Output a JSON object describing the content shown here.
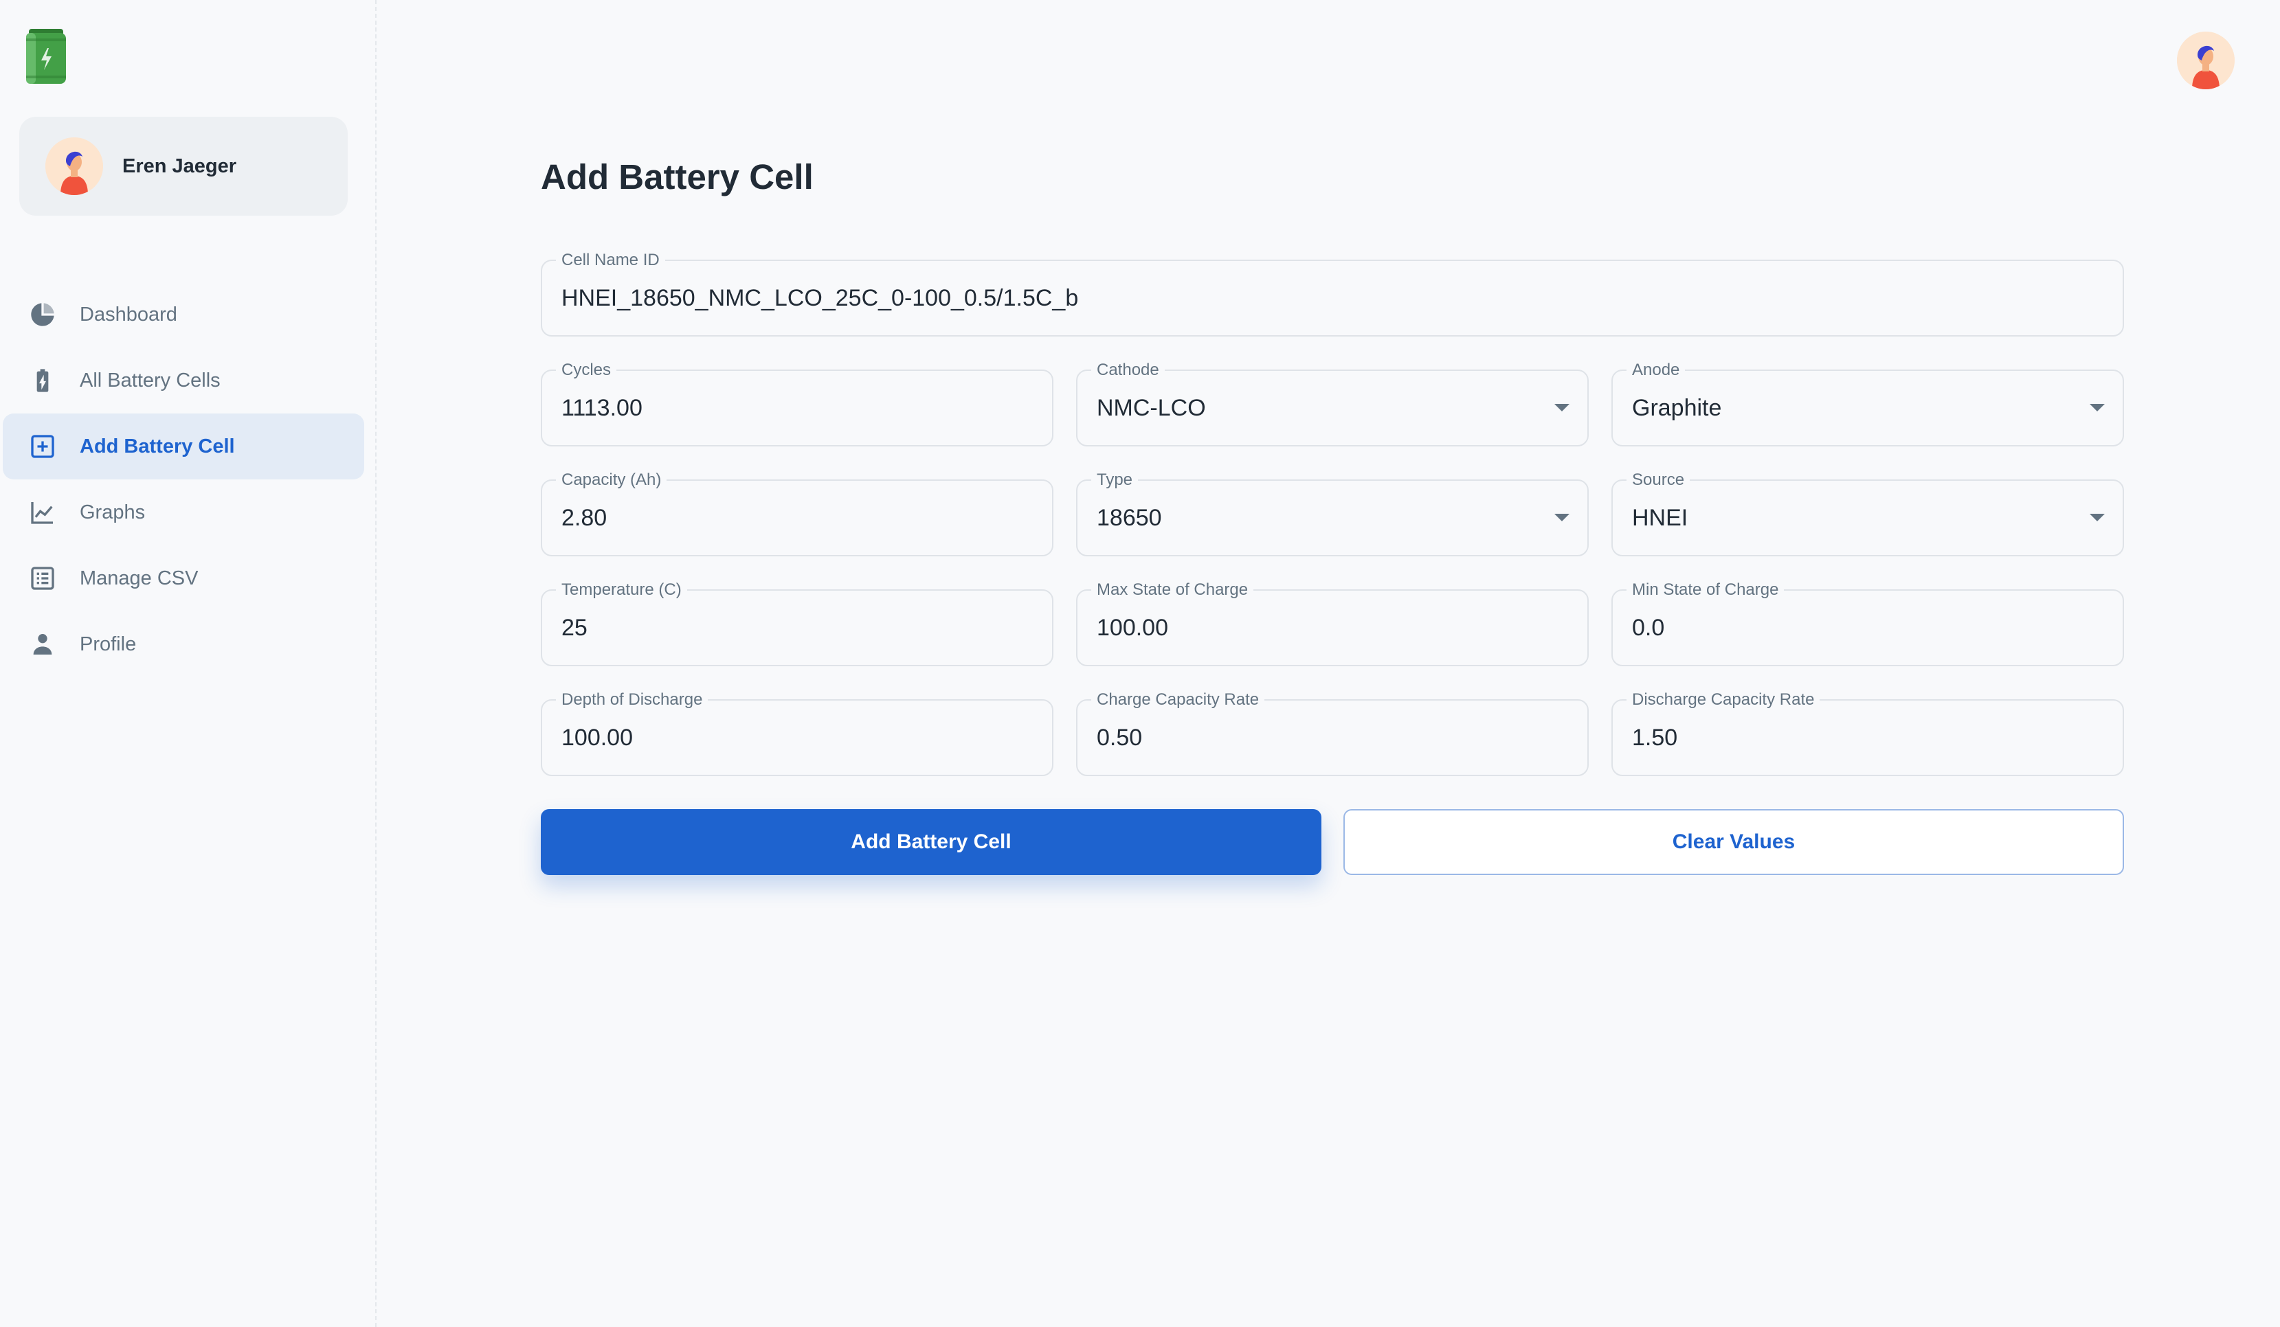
{
  "user": {
    "name": "Eren Jaeger"
  },
  "nav": {
    "items": [
      {
        "label": "Dashboard",
        "icon": "pie-chart-icon"
      },
      {
        "label": "All Battery Cells",
        "icon": "battery-charging-icon"
      },
      {
        "label": "Add Battery Cell",
        "icon": "plus-square-icon",
        "active": true
      },
      {
        "label": "Graphs",
        "icon": "line-chart-icon"
      },
      {
        "label": "Manage CSV",
        "icon": "list-icon"
      },
      {
        "label": "Profile",
        "icon": "person-icon"
      }
    ]
  },
  "page": {
    "title": "Add Battery Cell"
  },
  "form": {
    "cell_name_id": {
      "label": "Cell Name ID",
      "value": "HNEI_18650_NMC_LCO_25C_0-100_0.5/1.5C_b"
    },
    "cycles": {
      "label": "Cycles",
      "value": "1113.00"
    },
    "cathode": {
      "label": "Cathode",
      "value": "NMC-LCO"
    },
    "anode": {
      "label": "Anode",
      "value": "Graphite"
    },
    "capacity": {
      "label": "Capacity (Ah)",
      "value": "2.80"
    },
    "type": {
      "label": "Type",
      "value": "18650"
    },
    "source": {
      "label": "Source",
      "value": "HNEI"
    },
    "temperature": {
      "label": "Temperature (C)",
      "value": "25"
    },
    "max_soc": {
      "label": "Max State of Charge",
      "value": "100.00"
    },
    "min_soc": {
      "label": "Min State of Charge",
      "value": "0.0"
    },
    "dod": {
      "label": "Depth of Discharge",
      "value": "100.00"
    },
    "charge_rate": {
      "label": "Charge Capacity Rate",
      "value": "0.50"
    },
    "discharge_rate": {
      "label": "Discharge Capacity Rate",
      "value": "1.50"
    }
  },
  "actions": {
    "submit_label": "Add Battery Cell",
    "clear_label": "Clear Values"
  },
  "colors": {
    "primary": "#1e63cf",
    "active_bg": "#e3ebf6",
    "text": "#212b36",
    "muted": "#637381"
  }
}
